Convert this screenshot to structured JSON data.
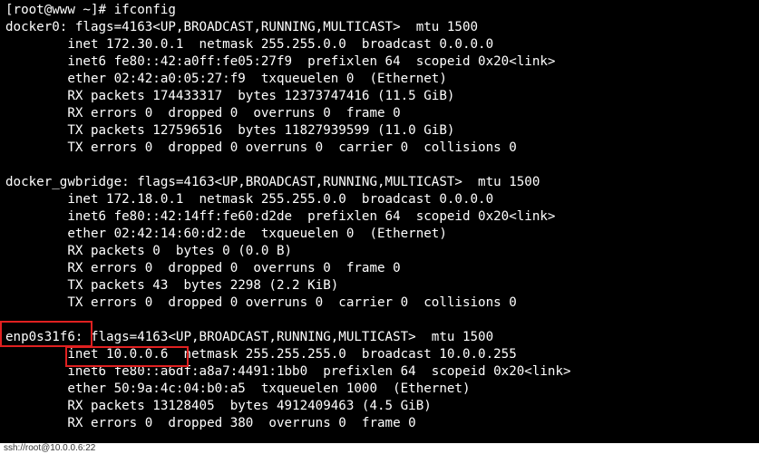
{
  "terminal": {
    "lines": [
      "[root@www ~]# ifconfig",
      "docker0: flags=4163<UP,BROADCAST,RUNNING,MULTICAST>  mtu 1500",
      "        inet 172.30.0.1  netmask 255.255.0.0  broadcast 0.0.0.0",
      "        inet6 fe80::42:a0ff:fe05:27f9  prefixlen 64  scopeid 0x20<link>",
      "        ether 02:42:a0:05:27:f9  txqueuelen 0  (Ethernet)",
      "        RX packets 174433317  bytes 12373747416 (11.5 GiB)",
      "        RX errors 0  dropped 0  overruns 0  frame 0",
      "        TX packets 127596516  bytes 11827939599 (11.0 GiB)",
      "        TX errors 0  dropped 0 overruns 0  carrier 0  collisions 0",
      "",
      "docker_gwbridge: flags=4163<UP,BROADCAST,RUNNING,MULTICAST>  mtu 1500",
      "        inet 172.18.0.1  netmask 255.255.0.0  broadcast 0.0.0.0",
      "        inet6 fe80::42:14ff:fe60:d2de  prefixlen 64  scopeid 0x20<link>",
      "        ether 02:42:14:60:d2:de  txqueuelen 0  (Ethernet)",
      "        RX packets 0  bytes 0 (0.0 B)",
      "        RX errors 0  dropped 0  overruns 0  frame 0",
      "        TX packets 43  bytes 2298 (2.2 KiB)",
      "        TX errors 0  dropped 0 overruns 0  carrier 0  collisions 0",
      "",
      "enp0s31f6: flags=4163<UP,BROADCAST,RUNNING,MULTICAST>  mtu 1500",
      "        inet 10.0.0.6  netmask 255.255.255.0  broadcast 10.0.0.255",
      "        inet6 fe80::a6df:a8a7:4491:1bb0  prefixlen 64  scopeid 0x20<link>",
      "        ether 50:9a:4c:04:b0:a5  txqueuelen 1000  (Ethernet)",
      "        RX packets 13128405  bytes 4912409463 (4.5 GiB)",
      "        RX errors 0  dropped 380  overruns 0  frame 0"
    ]
  },
  "statusbar": {
    "text": "ssh://root@10.0.0.6:22"
  },
  "colors": {
    "background": "#000000",
    "text": "#ffffff",
    "highlight": "#e02020",
    "statusbar_bg": "#ffffff"
  }
}
